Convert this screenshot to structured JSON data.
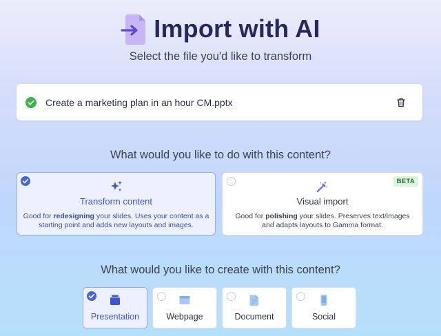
{
  "header": {
    "title": "Import with AI",
    "subtitle": "Select the file you'd like to transform"
  },
  "file": {
    "name": "Create a marketing plan in an hour CM.pptx",
    "status": "uploaded"
  },
  "transform_section": {
    "heading": "What would you like to do with this content?",
    "options": [
      {
        "title": "Transform content",
        "desc_prefix": "Good for ",
        "desc_bold": "redesigning",
        "desc_line1_rest": " your slides. Uses your content as a",
        "desc_line2": "starting point and adds new layouts and images.",
        "selected": true
      },
      {
        "title": "Visual import",
        "badge": "BETA",
        "desc_prefix": "Good for ",
        "desc_bold": "polishing",
        "desc_line1_rest": " your slides. Preserves text/images",
        "desc_line2": "and adapts layouts to Gamma format.",
        "selected": false
      }
    ]
  },
  "create_section": {
    "heading": "What would you like to create with this content?",
    "types": [
      {
        "label": "Presentation",
        "selected": true
      },
      {
        "label": "Webpage",
        "selected": false
      },
      {
        "label": "Document",
        "selected": false
      },
      {
        "label": "Social",
        "selected": false
      }
    ]
  },
  "colors": {
    "accent": "#4a63d8",
    "success": "#3bb54a",
    "title": "#26285e"
  }
}
